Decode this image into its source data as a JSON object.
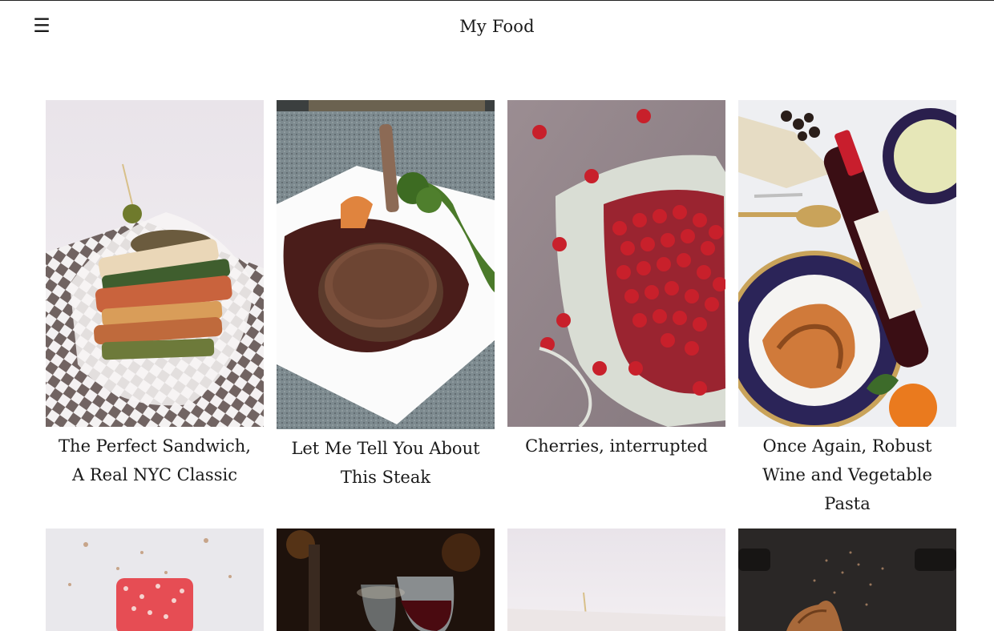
{
  "header": {
    "menu_icon": "☰",
    "title": "My Food"
  },
  "posts": [
    {
      "title": "The Perfect Sandwich, A Real NYC Classic",
      "image": "sandwich-photo"
    },
    {
      "title": "Let Me Tell You About This Steak",
      "image": "steak-photo"
    },
    {
      "title": "Cherries, interrupted",
      "image": "cherries-photo"
    },
    {
      "title": "Once Again, Robust Wine and Vegetable Pasta",
      "image": "wine-pasta-photo"
    }
  ],
  "more_posts": [
    {
      "image": "marshmallow-photo"
    },
    {
      "image": "wine-glasses-photo"
    },
    {
      "image": "sandwich-photo"
    },
    {
      "image": "croissant-photo"
    }
  ],
  "icons": {
    "menu": "hamburger-menu-icon"
  },
  "colors": {
    "text": "#1a1a1a",
    "background": "#ffffff"
  }
}
